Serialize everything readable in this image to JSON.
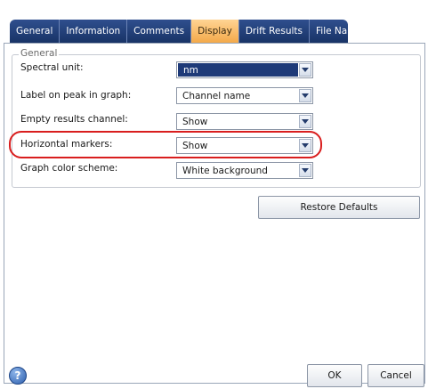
{
  "tabs": [
    {
      "label": "General",
      "active": false
    },
    {
      "label": "Information",
      "active": false
    },
    {
      "label": "Comments",
      "active": false
    },
    {
      "label": "Display",
      "active": true
    },
    {
      "label": "Drift Results",
      "active": false
    },
    {
      "label": "File Name",
      "active": false
    }
  ],
  "group": {
    "title": "General",
    "rows": [
      {
        "label": "Spectral unit:",
        "value": "nm"
      },
      {
        "label": "Label on peak in graph:",
        "value": "Channel name"
      },
      {
        "label": "Empty results channel:",
        "value": "Show"
      },
      {
        "label": "Horizontal markers:",
        "value": "Show"
      },
      {
        "label": "Graph color scheme:",
        "value": "White background"
      }
    ]
  },
  "buttons": {
    "restore_defaults": "Restore Defaults",
    "ok": "OK",
    "cancel": "Cancel",
    "help": "?"
  },
  "colors": {
    "tab_bar": "#1f3d7a",
    "active_tab": "#f6b358",
    "highlight_ring": "#d91e1e",
    "focused_select": "#1e3a78"
  },
  "icons": {
    "help": "question-circle-icon",
    "dropdown": "chevron-down-icon"
  }
}
